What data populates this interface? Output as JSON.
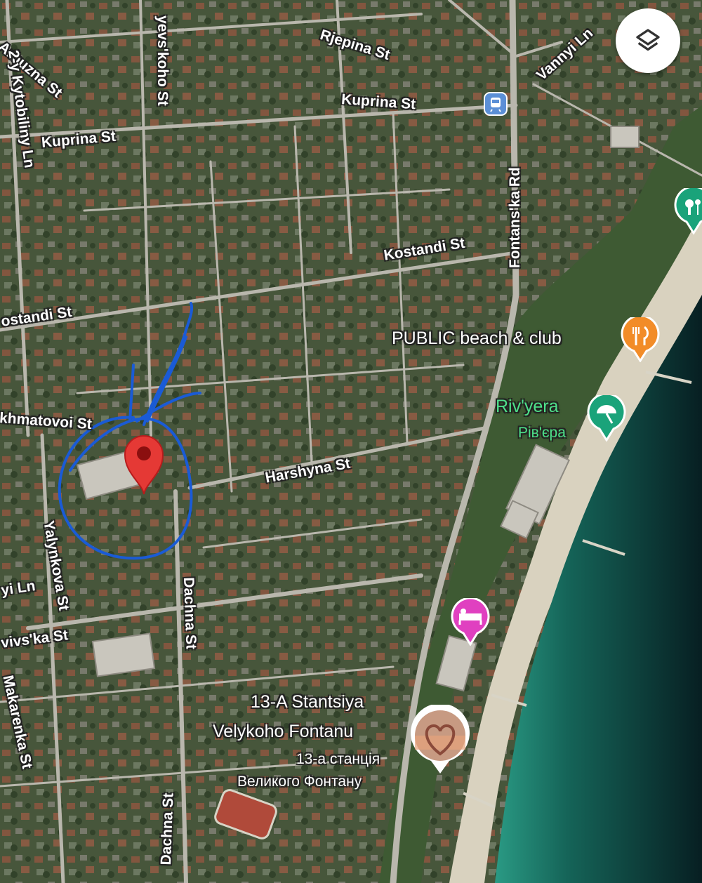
{
  "streets": {
    "arbuzna": "Arbuzna St",
    "kytobiliny": "2-y Kytobiliny Ln",
    "yevs": "yevs'koho St",
    "rjepina": "Rjepina St",
    "vannyi": "Vannyi Ln",
    "kuprina_top": "Kuprina St",
    "kuprina_left": "Kuprina St",
    "fontanska": "Fontans'ka Rd",
    "kostandi_right": "Kostandi St",
    "kostandi_left": "ostandi St",
    "akhmatovoi": "khmatovoi St",
    "harshyna": "Harshyna St",
    "yalynkova": "Yalynkova St",
    "dachna_mid": "Dachna St",
    "dachna_bottom": "Dachna St",
    "yi_ln": "yi Ln",
    "vivska": "vivs'ka St",
    "makarenka": "Makarenka St"
  },
  "pois": {
    "public_beach": "PUBLIC beach & club",
    "rivyera": "Riv'yera",
    "rivyera_local": "Рів'єра",
    "stantsiya_line1": "13-A Stantsiya",
    "stantsiya_line2": "Velykoho Fontanu",
    "stantsiya_local1": "13-а станція",
    "stantsiya_local2": "Великого Фонтану"
  },
  "icons": {
    "layers": "layers-icon",
    "transit": "transit-station-icon",
    "restaurant": "fork-knife-icon",
    "beach": "beach-umbrella-icon",
    "hotel": "hotel-bed-icon",
    "park": "park-icon",
    "location_pin": "location-pin-icon",
    "annotation": "hand-drawn-circle"
  },
  "colors": {
    "sea_deep": "#0b2a2a",
    "sea_shallow": "#1f7a6a",
    "pin_red": "#e53935",
    "annotation_blue": "#1a5bd6",
    "restaurant_orange": "#f28c28",
    "beach_green": "#1aa37a",
    "hotel_pink": "#e040c0"
  }
}
